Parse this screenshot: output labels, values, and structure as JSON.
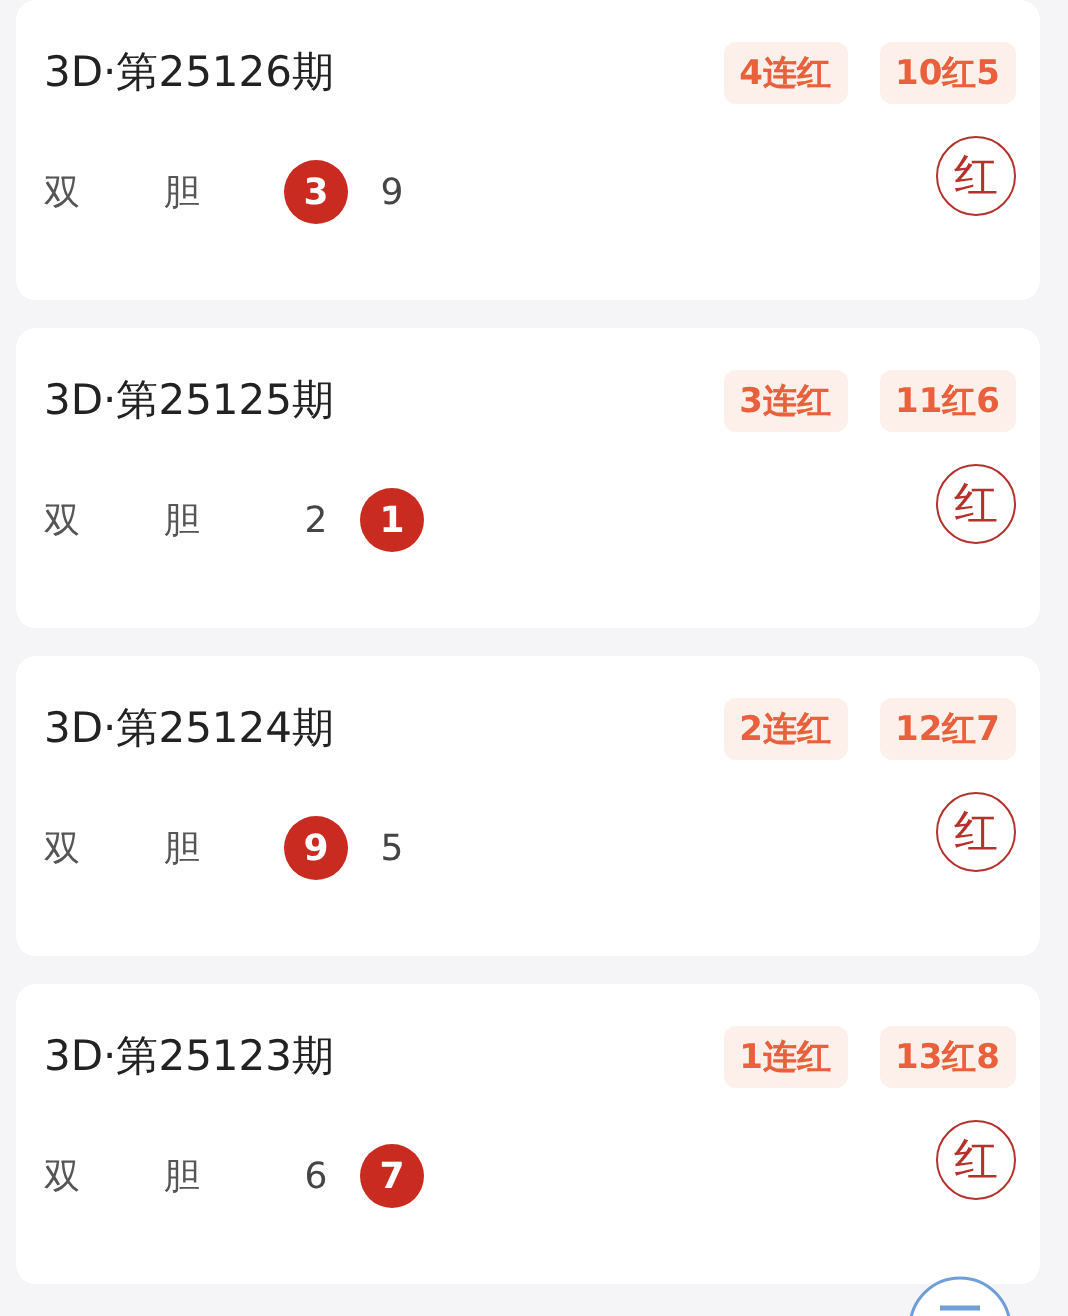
{
  "cards": [
    {
      "title": "3D·第25126期",
      "badges": [
        "4连红",
        "10红5"
      ],
      "labels": [
        "双",
        "胆"
      ],
      "numbers": [
        {
          "text": "3",
          "highlighted": true
        },
        {
          "text": "9",
          "highlighted": false
        }
      ],
      "result": "红"
    },
    {
      "title": "3D·第25125期",
      "badges": [
        "3连红",
        "11红6"
      ],
      "labels": [
        "双",
        "胆"
      ],
      "numbers": [
        {
          "text": "2",
          "highlighted": false
        },
        {
          "text": "1",
          "highlighted": true
        }
      ],
      "result": "红"
    },
    {
      "title": "3D·第25124期",
      "badges": [
        "2连红",
        "12红7"
      ],
      "labels": [
        "双",
        "胆"
      ],
      "numbers": [
        {
          "text": "9",
          "highlighted": true
        },
        {
          "text": "5",
          "highlighted": false
        }
      ],
      "result": "红"
    },
    {
      "title": "3D·第25123期",
      "badges": [
        "1连红",
        "13红8"
      ],
      "labels": [
        "双",
        "胆"
      ],
      "numbers": [
        {
          "text": "6",
          "highlighted": false
        },
        {
          "text": "7",
          "highlighted": true
        }
      ],
      "result": "红"
    }
  ]
}
